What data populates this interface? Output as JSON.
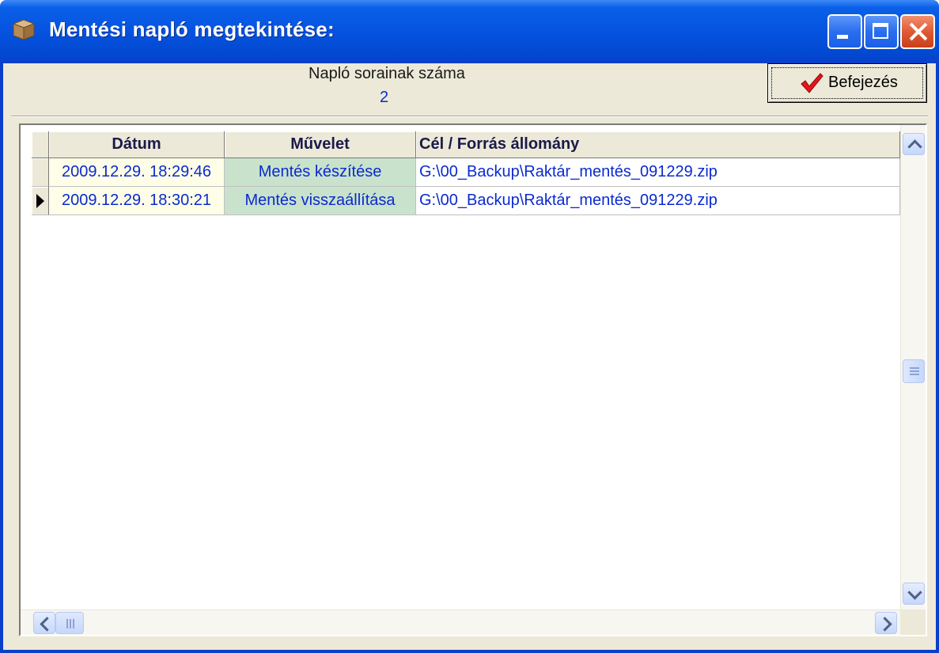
{
  "window": {
    "title": "Mentési napló megtekintése:",
    "icon": "box-icon",
    "controls": [
      "minimize-icon",
      "maximize-icon",
      "close-icon"
    ]
  },
  "info": {
    "label": "Napló sorainak száma",
    "count": "2"
  },
  "finish_button": {
    "label": "Befejezés",
    "icon": "checkmark-icon"
  },
  "table": {
    "columns": [
      "Dátum",
      "Művelet",
      "Cél / Forrás állomány"
    ],
    "rows": [
      {
        "datum": "2009.12.29. 18:29:46",
        "muvelet": "Mentés készítése",
        "allomany": "G:\\00_Backup\\Raktár_mentés_091229.zip",
        "current": false
      },
      {
        "datum": "2009.12.29. 18:30:21",
        "muvelet": "Mentés visszaállítása",
        "allomany": "G:\\00_Backup\\Raktár_mentés_091229.zip",
        "current": true
      }
    ]
  },
  "colors": {
    "titlebar": "#0553e0",
    "value_text": "#0a2ad0",
    "date_cell_bg": "#fefee8",
    "operation_cell_bg": "#c9e2cc",
    "close_button": "#e15a33",
    "window_bg": "#ece9d8"
  }
}
